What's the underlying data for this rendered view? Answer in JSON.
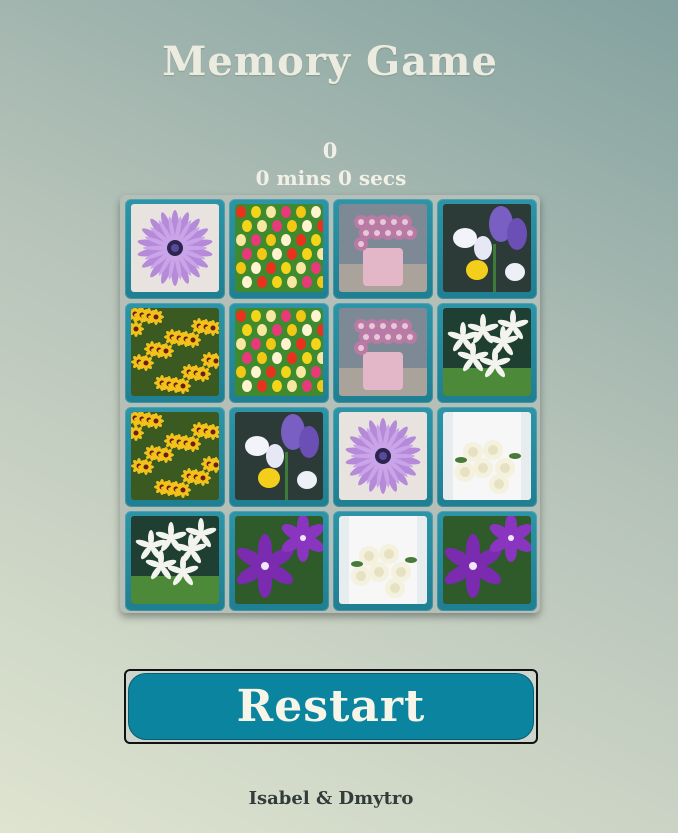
{
  "header": {
    "title": "Memory Game"
  },
  "stats": {
    "moves": "0",
    "timer": "0 mins 0 secs"
  },
  "board": {
    "cards": [
      {
        "flower": "purple-daisy-icon"
      },
      {
        "flower": "tulip-field-icon"
      },
      {
        "flower": "pink-rose-box-icon"
      },
      {
        "flower": "crocus-icon"
      },
      {
        "flower": "yellow-wildflower-icon"
      },
      {
        "flower": "tulip-field-icon"
      },
      {
        "flower": "pink-rose-box-icon"
      },
      {
        "flower": "white-lily-icon"
      },
      {
        "flower": "yellow-wildflower-icon"
      },
      {
        "flower": "crocus-icon"
      },
      {
        "flower": "purple-daisy-icon"
      },
      {
        "flower": "white-rose-bouquet-icon"
      },
      {
        "flower": "white-lily-icon"
      },
      {
        "flower": "purple-clematis-icon"
      },
      {
        "flower": "white-rose-bouquet-icon"
      },
      {
        "flower": "purple-clematis-icon"
      }
    ]
  },
  "controls": {
    "restart_label": "Restart"
  },
  "footer": {
    "credits": "Isabel & Dmytro"
  },
  "colors": {
    "card_frame": "#1f8698",
    "restart_bg": "#0b84a0",
    "title_text": "#ecebdf"
  }
}
